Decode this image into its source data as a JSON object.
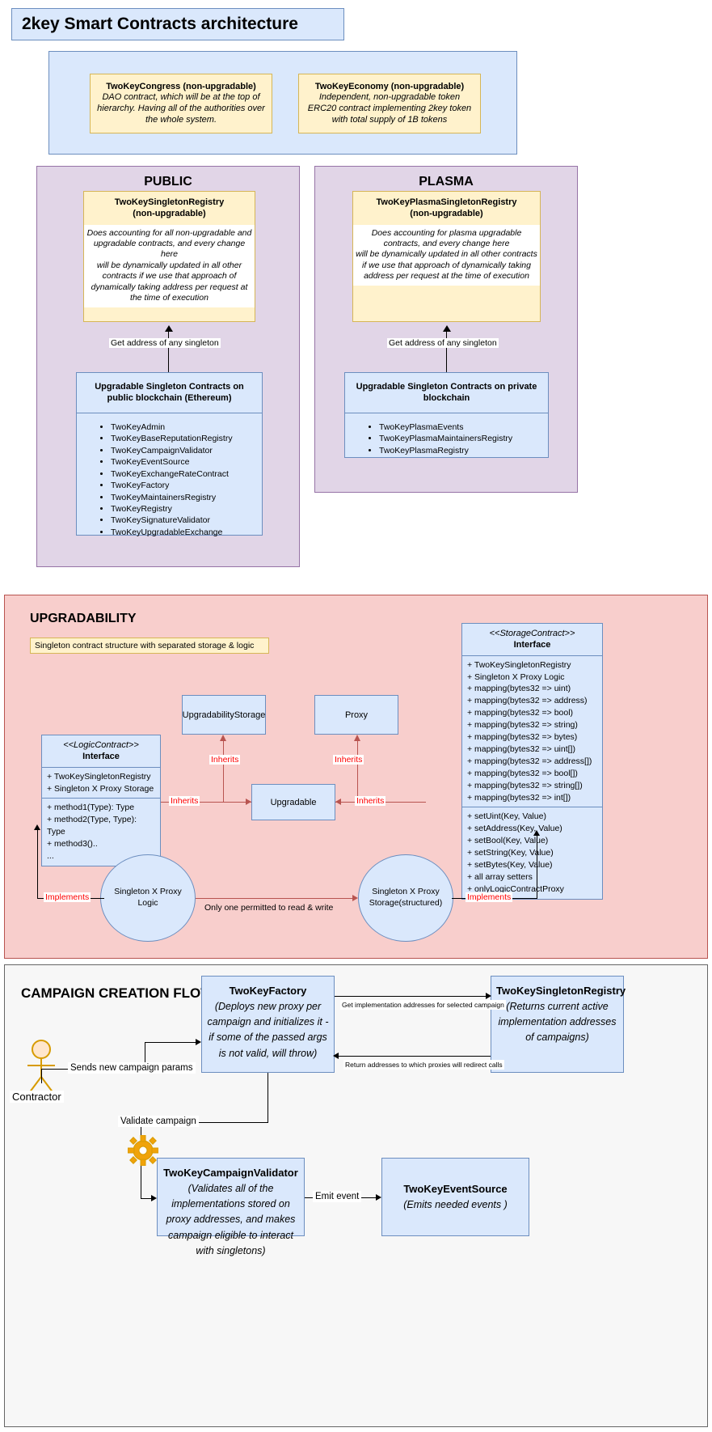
{
  "title": "2key Smart Contracts architecture",
  "top_section": {
    "boxes": [
      {
        "title": "TwoKeyCongress (non-upgradable)",
        "body": "DAO contract, which will be at the top of hierarchy. Having all of the authorities over the whole system."
      },
      {
        "title": "TwoKeyEconomy (non-upgradable)",
        "body": "Independent, non-upgradable token ERC20 contract implementing 2key token with total supply of 1B tokens"
      }
    ]
  },
  "public_panel": {
    "title": "PUBLIC",
    "registry": {
      "name": "TwoKeySingletonRegistry",
      "subtitle": "(non-upgradable)",
      "body": "Does accounting for all non-upgradable and upgradable contracts, and every change here\nwill be dynamically updated in all other contracts if we use that approach of dynamically taking address per request at the time of execution"
    },
    "arrow_label": "Get address of any singleton",
    "contracts": {
      "header": "Upgradable Singleton Contracts on public blockchain (Ethereum)",
      "items": [
        "TwoKeyAdmin",
        "TwoKeyBaseReputationRegistry",
        "TwoKeyCampaignValidator",
        "TwoKeyEventSource",
        "TwoKeyExchangeRateContract",
        "TwoKeyFactory",
        "TwoKeyMaintainersRegistry",
        "TwoKeyRegistry",
        "TwoKeySignatureValidator",
        "TwoKeyUpgradableExchange"
      ]
    }
  },
  "plasma_panel": {
    "title": "PLASMA",
    "registry": {
      "name": "TwoKeyPlasmaSingletonRegistry",
      "subtitle": "(non-upgradable)",
      "body": "Does accounting for plasma upgradable contracts, and every change here\nwill be dynamically updated in all other contracts if we use that approach of dynamically taking address per request at the time of execution"
    },
    "arrow_label": "Get address of any singleton",
    "contracts": {
      "header": "Upgradable Singleton Contracts on private blockchain",
      "items": [
        "TwoKeyPlasmaEvents",
        "TwoKeyPlasmaMaintainersRegistry",
        "TwoKeyPlasmaRegistry"
      ]
    }
  },
  "upgradability": {
    "title": "UPGRADABILITY",
    "note": "Singleton contract structure with separated storage & logic",
    "storage_interface": {
      "stereotype": "<<StorageContract>>",
      "name": "Interface",
      "attributes": [
        "+ TwoKeySingletonRegistry",
        "+ Singleton X Proxy Logic",
        "+ mapping(bytes32 => uint)",
        "+ mapping(bytes32 => address)",
        "+ mapping(bytes32 => bool)",
        "+ mapping(bytes32 => string)",
        "+ mapping(bytes32 => bytes)",
        "+ mapping(bytes32 => uint[])",
        "+ mapping(bytes32 => address[])",
        "+ mapping(bytes32 => bool[])",
        "+ mapping(bytes32 => string[])",
        "+ mapping(bytes32 => int[])"
      ],
      "methods": [
        "+ setUint(Key, Value)",
        "+ setAddress(Key, Value)",
        "+ setBool(Key, Value)",
        "+ setString(Key, Value)",
        "+ setBytes(Key, Value)",
        "+ all array setters",
        "+ onlyLogicContractProxy"
      ]
    },
    "logic_interface": {
      "stereotype": "<<LogicContract>>",
      "name": "Interface",
      "attributes": [
        "+ TwoKeySingletonRegistry",
        "+ Singleton X Proxy Storage"
      ],
      "methods": [
        "+ method1(Type): Type",
        "+ method2(Type, Type): Type",
        "+ method3()..",
        "..."
      ]
    },
    "nodes": {
      "upgradability_storage": "UpgradabilityStorage",
      "proxy": "Proxy",
      "upgradable": "Upgradable",
      "ellipse_logic": "Singleton X Proxy Logic",
      "ellipse_storage": "Singleton X Proxy Storage(structured)"
    },
    "edges": {
      "inherits": "Inherits",
      "implements": "Implements",
      "read_write": "Only one permitted to read & write"
    }
  },
  "campaign_flow": {
    "title": "CAMPAIGN CREATION FLOW",
    "actor": "Contractor",
    "boxes": {
      "factory": {
        "name": "TwoKeyFactory",
        "desc": "(Deploys new proxy per campaign and initializes it - if some of the passed args is not valid, will throw)"
      },
      "registry": {
        "name": "TwoKeySingletonRegistry",
        "desc": "(Returns current active implementation addresses of campaigns)"
      },
      "validator": {
        "name": "TwoKeyCampaignValidator",
        "desc": "(Validates all of the implementations stored on proxy addresses, and makes campaign eligible to interact with singletons)"
      },
      "event_source": {
        "name": "TwoKeyEventSource",
        "desc": "(Emits needed events )"
      }
    },
    "labels": {
      "sends_params": "Sends new campaign params",
      "get_impl": "Get implementation addresses for selected campaign",
      "return_addr": "Return addresses to which proxies will redirect calls",
      "validate": "Validate campaign",
      "emit_event": "Emit event"
    }
  },
  "colors": {
    "blue_fill": "#dae8fc",
    "blue_stroke": "#6c8ebf",
    "yellow_fill": "#fff2cc",
    "yellow_stroke": "#d6b656",
    "purple_fill": "#e1d5e7",
    "purple_stroke": "#9673a6",
    "red_fill": "#f8cecc",
    "red_stroke": "#b85450",
    "gray_fill": "#f7f7f7",
    "accent_red": "#ff0000",
    "actor_fill": "#ffe6cc"
  }
}
